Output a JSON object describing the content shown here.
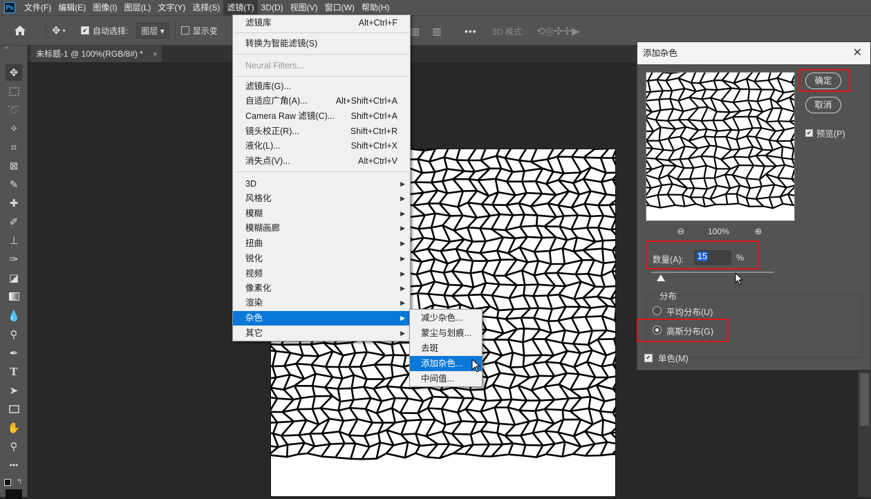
{
  "menubar": {
    "logo": "Ps",
    "items": [
      "文件(F)",
      "编辑(E)",
      "图像(I)",
      "图层(L)",
      "文字(Y)",
      "选择(S)",
      "滤镜(T)",
      "3D(D)",
      "视图(V)",
      "窗口(W)",
      "帮助(H)"
    ],
    "active_index": 6
  },
  "options_bar": {
    "auto_select_label": "自动选择:",
    "auto_select_checked": true,
    "layer_dropdown": "图层",
    "show_transform_label": "显示变",
    "mode_3d_label": "3D 模式:",
    "more": "•••"
  },
  "document_tab": {
    "title": "未标题-1 @ 100%(RGB/8#) *",
    "close": "×"
  },
  "filter_menu": {
    "items": [
      {
        "label": "滤镜库",
        "shortcut": "Alt+Ctrl+F"
      },
      {
        "label": "转换为智能滤镜(S)",
        "shortcut": ""
      },
      {
        "label": "Neural Filters...",
        "shortcut": "",
        "disabled": true
      },
      {
        "label": "滤镜库(G)...",
        "shortcut": ""
      },
      {
        "label": "自适应广角(A)...",
        "shortcut": "Alt+Shift+Ctrl+A"
      },
      {
        "label": "Camera Raw 滤镜(C)...",
        "shortcut": "Shift+Ctrl+A"
      },
      {
        "label": "镜头校正(R)...",
        "shortcut": "Shift+Ctrl+R"
      },
      {
        "label": "液化(L)...",
        "shortcut": "Shift+Ctrl+X"
      },
      {
        "label": "消失点(V)...",
        "shortcut": "Alt+Ctrl+V"
      },
      {
        "label": "3D",
        "submenu": true
      },
      {
        "label": "风格化",
        "submenu": true
      },
      {
        "label": "模糊",
        "submenu": true
      },
      {
        "label": "模糊画廊",
        "submenu": true
      },
      {
        "label": "扭曲",
        "submenu": true
      },
      {
        "label": "锐化",
        "submenu": true
      },
      {
        "label": "视频",
        "submenu": true
      },
      {
        "label": "像素化",
        "submenu": true
      },
      {
        "label": "渲染",
        "submenu": true
      },
      {
        "label": "杂色",
        "submenu": true,
        "highlighted": true
      },
      {
        "label": "其它",
        "submenu": true
      }
    ],
    "arrow_glyph": "▶"
  },
  "noise_submenu": {
    "items": [
      "减少杂色...",
      "蒙尘与划痕...",
      "去斑",
      "添加杂色...",
      "中间值..."
    ],
    "highlighted_index": 3
  },
  "dialog": {
    "title": "添加杂色",
    "close": "✕",
    "ok_label": "确定",
    "cancel_label": "取消",
    "preview_label": "预览(P)",
    "preview_checked": true,
    "zoom_out": "⊖",
    "zoom_in": "⊕",
    "zoom_level": "100%",
    "amount_label": "数量(A):",
    "amount_value": "15",
    "amount_unit": "%",
    "amount_slider_fraction": 0.08,
    "distribution_label": "分布",
    "uniform_label": "平均分布(U)",
    "gaussian_label": "高斯分布(G)",
    "selected_distribution": "gaussian",
    "mono_label": "单色(M)",
    "mono_checked": true
  },
  "tools": [
    "move-icon",
    "marquee-icon",
    "lasso-icon",
    "magic-wand-icon",
    "crop-icon",
    "frame-icon",
    "eyedropper-icon",
    "healing-icon",
    "brush-icon",
    "stamp-icon",
    "history-brush-icon",
    "eraser-icon",
    "gradient-icon",
    "blur-icon",
    "dodge-icon",
    "pen-icon",
    "type-icon",
    "path-select-icon",
    "rectangle-icon",
    "hand-icon",
    "zoom-icon",
    "more-icon"
  ],
  "colors": {
    "highlight": "#0a78d7",
    "annotation": "#e0141c"
  }
}
